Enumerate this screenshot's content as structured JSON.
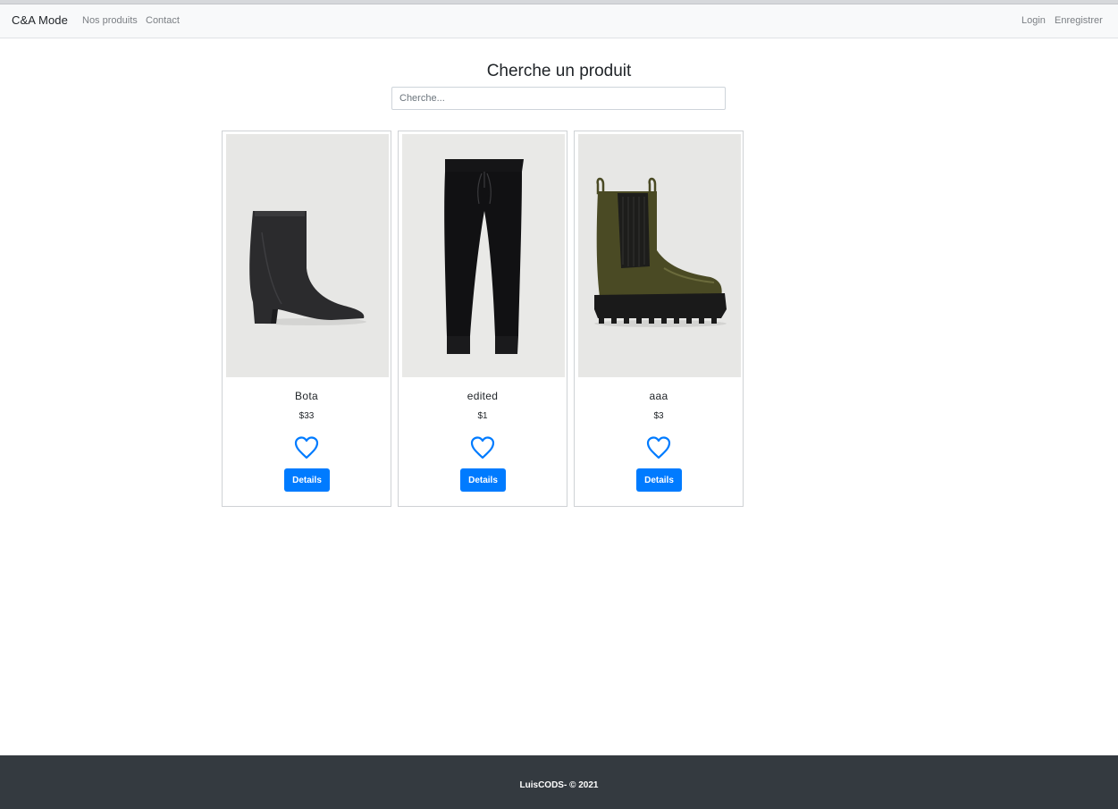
{
  "navbar": {
    "brand": "C&A Mode",
    "links": [
      "Nos produits",
      "Contact"
    ],
    "right_links": [
      "Login",
      "Enregistrer"
    ]
  },
  "search": {
    "title": "Cherche un produit",
    "placeholder": "Cherche..."
  },
  "products": [
    {
      "name": "Bota",
      "price": "$33",
      "button": "Details",
      "image": "black-ankle-boot"
    },
    {
      "name": "edited",
      "price": "$1",
      "button": "Details",
      "image": "black-jogger-pants"
    },
    {
      "name": "aaa",
      "price": "$3",
      "button": "Details",
      "image": "olive-chelsea-boot"
    }
  ],
  "footer": {
    "text": "LuisCODS- © 2021"
  },
  "colors": {
    "primary": "#007bff",
    "navbar_bg": "#f8f9fa",
    "footer_bg": "#343a40"
  }
}
